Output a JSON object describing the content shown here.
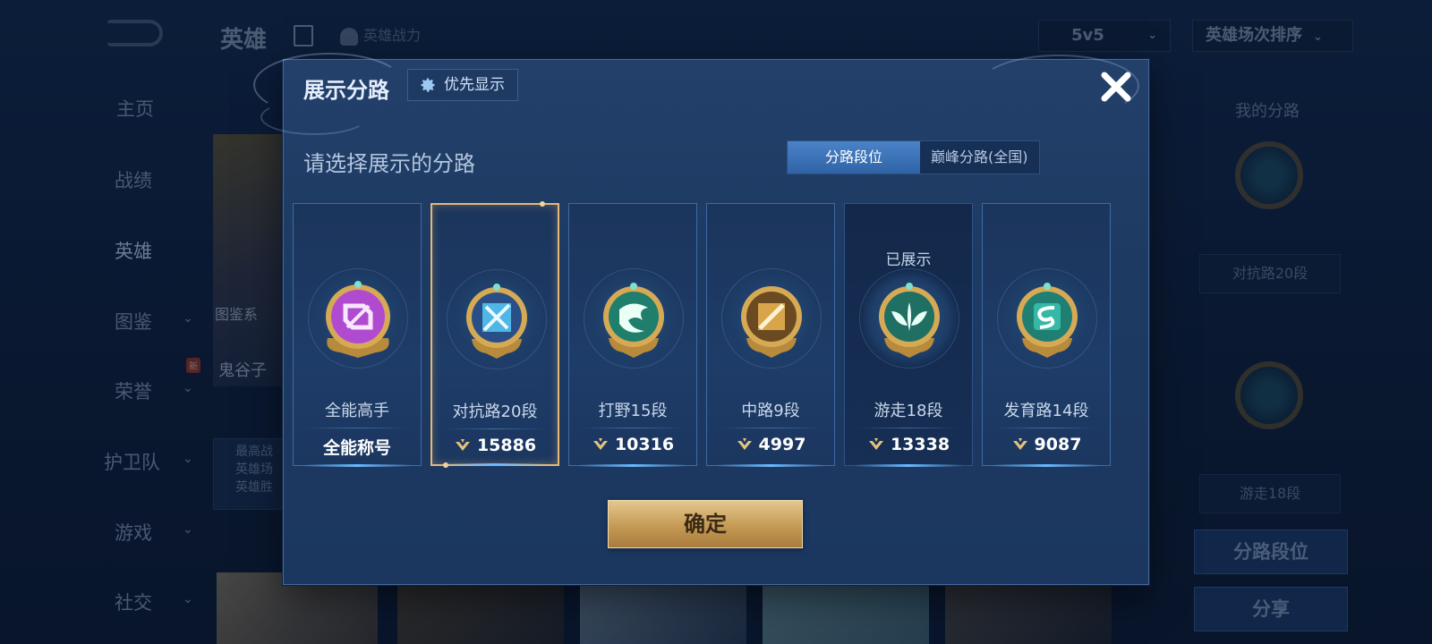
{
  "background": {
    "title": "英雄",
    "power_label": "英雄战力",
    "mode": "5v5",
    "sort": "英雄场次排序",
    "nav": [
      {
        "label": "主页"
      },
      {
        "label": "战绩"
      },
      {
        "label": "英雄"
      },
      {
        "label": "图鉴"
      },
      {
        "label": "荣誉"
      },
      {
        "label": "护卫队"
      },
      {
        "label": "游戏"
      },
      {
        "label": "社交"
      }
    ],
    "new_badge": "新",
    "hero_caption": "图鉴系",
    "hero_name": "鬼谷子",
    "stats_lines": [
      "最高战",
      "英雄场",
      "英雄胜"
    ],
    "right_title": "我的分路",
    "right_label_1": "对抗路20段",
    "right_label_2": "游走18段",
    "right_btn_1": "分路段位",
    "right_btn_2": "分享"
  },
  "dialog": {
    "title": "展示分路",
    "priority_label": "优先显示",
    "subtitle": "请选择展示的分路",
    "tabs": [
      {
        "label": "分路段位",
        "active": true
      },
      {
        "label": "巅峰分路(全国)",
        "active": false
      }
    ],
    "shown_tag": "已展示",
    "cards": [
      {
        "lane": "全能高手",
        "value": "全能称号",
        "color": "#b04bd0"
      },
      {
        "lane": "对抗路20段",
        "value": "15886",
        "color": "#4fb6e6"
      },
      {
        "lane": "打野15段",
        "value": "10316",
        "color": "#2fa88f"
      },
      {
        "lane": "中路9段",
        "value": "4997",
        "color": "#d9a54a"
      },
      {
        "lane": "游走18段",
        "value": "13338",
        "color": "#2f9f8c"
      },
      {
        "lane": "发育路14段",
        "value": "9087",
        "color": "#35b9a6"
      }
    ],
    "confirm_label": "确定"
  }
}
